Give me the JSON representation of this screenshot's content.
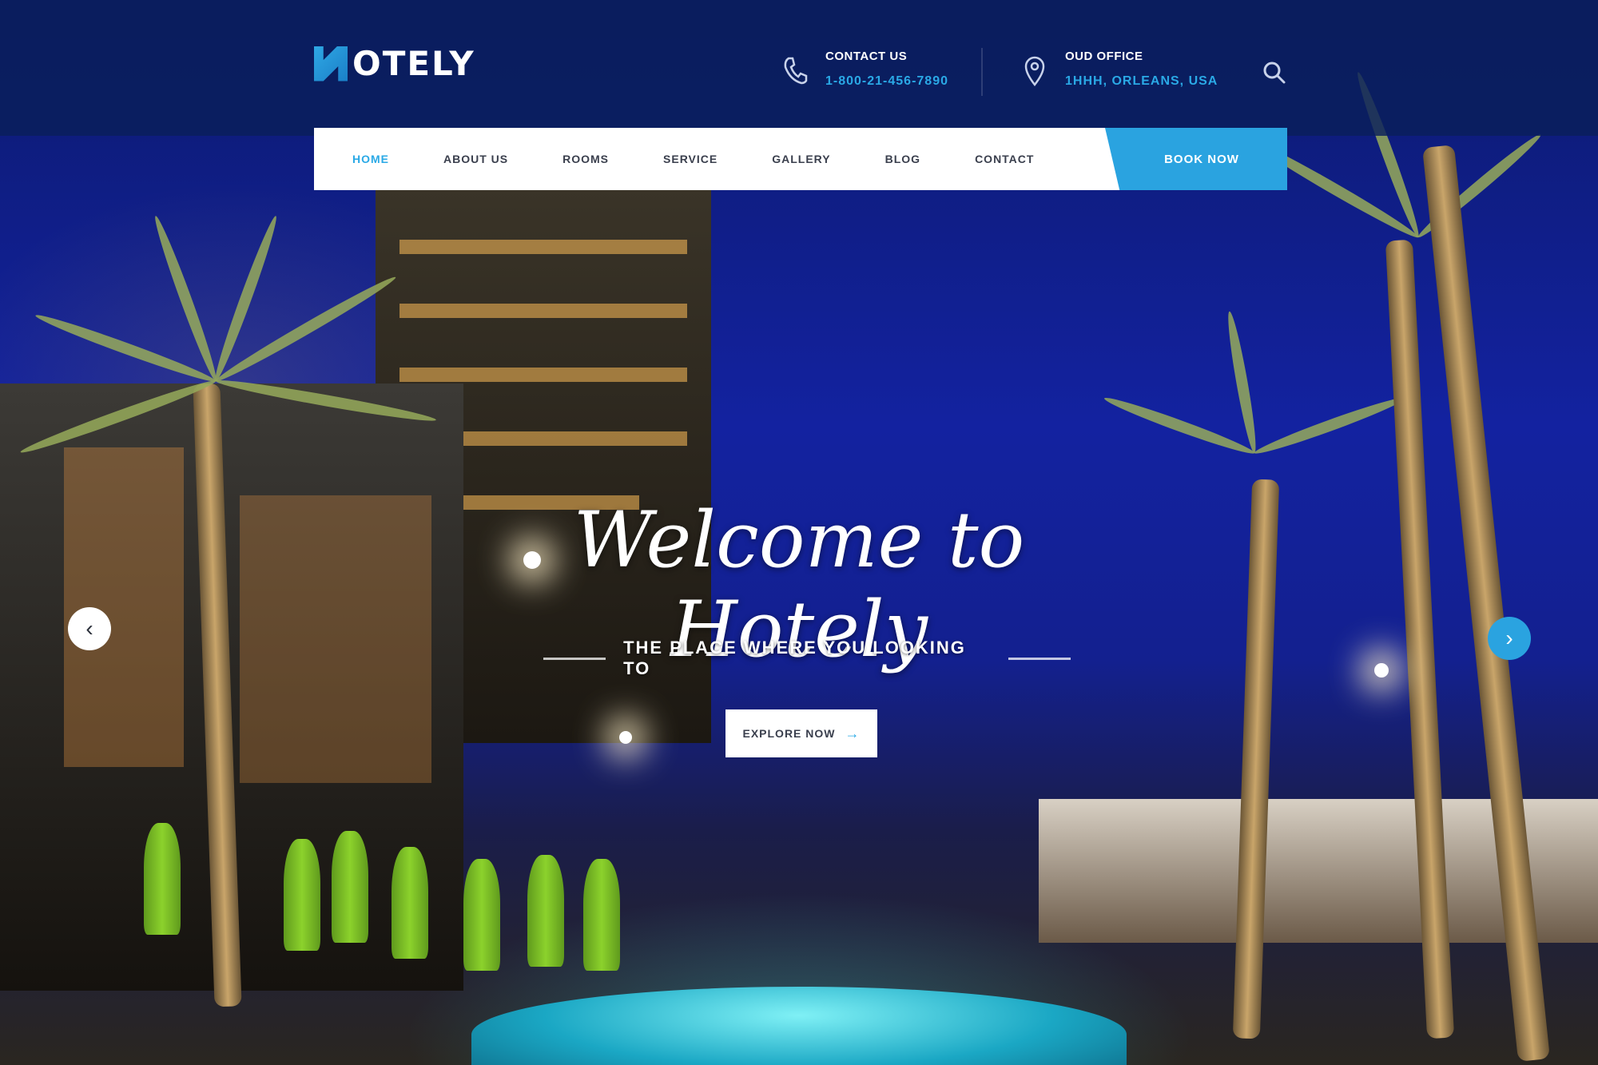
{
  "brand": {
    "name": "OTELY",
    "accent_color": "#2aa3e0",
    "header_color": "#0a1e5a"
  },
  "header": {
    "contact": {
      "icon": "phone-icon",
      "label": "CONTACT US",
      "value": "1-800-21-456-7890"
    },
    "office": {
      "icon": "map-pin-icon",
      "label": "OUD OFFICE",
      "value": "1HHH, ORLEANS, USA"
    },
    "search_icon": "search-icon"
  },
  "nav": {
    "items": [
      {
        "label": "HOME",
        "active": true
      },
      {
        "label": "ABOUT US"
      },
      {
        "label": "ROOMS"
      },
      {
        "label": "SERVICE"
      },
      {
        "label": "GALLERY"
      },
      {
        "label": "BLOG"
      },
      {
        "label": "CONTACT"
      }
    ],
    "book_label": "BOOK NOW"
  },
  "hero": {
    "title": "Welcome to Hotely",
    "tagline": "THE PLACE WHERE YOU LOOKING TO",
    "cta_label": "EXPLORE NOW",
    "cta_arrow": "→",
    "prev_arrow": "‹",
    "next_arrow": "›"
  }
}
